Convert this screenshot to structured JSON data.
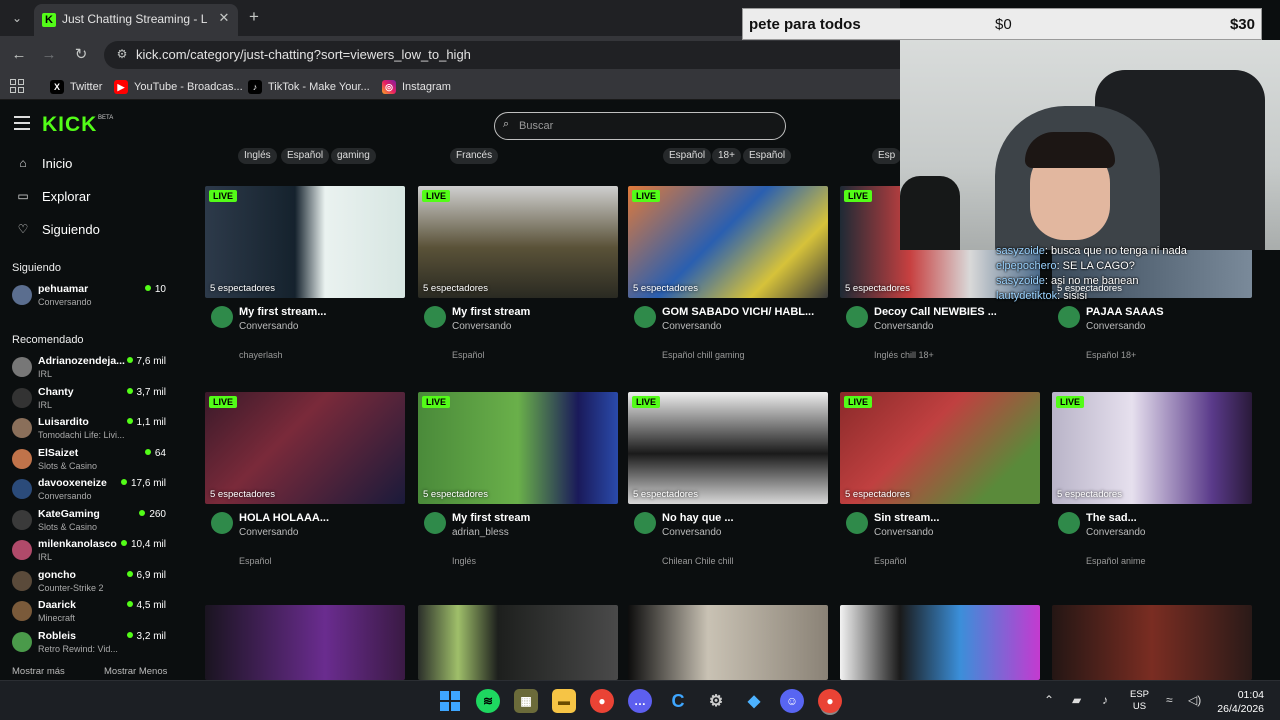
{
  "browser": {
    "tab_title": "Just Chatting Streaming - Live S",
    "url": "kick.com/category/just-chatting?sort=viewers_low_to_high",
    "bookmarks": [
      {
        "label": "Twitter",
        "icon": "x-icon"
      },
      {
        "label": "YouTube - Broadcas...",
        "icon": "youtube-icon"
      },
      {
        "label": "TikTok - Make Your...",
        "icon": "tiktok-icon"
      },
      {
        "label": "Instagram",
        "icon": "instagram-icon"
      }
    ]
  },
  "colors": {
    "accent": "#53fc18",
    "background": "#0b0e0f"
  },
  "kick": {
    "logo": "KICK",
    "logo_badge": "BETA",
    "search_placeholder": "Buscar",
    "nav": [
      {
        "label": "Inicio",
        "icon": "home-icon"
      },
      {
        "label": "Explorar",
        "icon": "explore-icon"
      },
      {
        "label": "Siguiendo",
        "icon": "heart-icon"
      }
    ],
    "following_header": "Siguiendo",
    "following": [
      {
        "name": "pehuamar",
        "category": "Conversando",
        "viewers": "10"
      }
    ],
    "recommended_header": "Recomendado",
    "recommended": [
      {
        "name": "Adrianozendeja...",
        "category": "IRL",
        "viewers": "7,6 mil"
      },
      {
        "name": "Chanty",
        "category": "IRL",
        "viewers": "3,7 mil"
      },
      {
        "name": "Luisardito",
        "category": "Tomodachi Life: Livi...",
        "viewers": "1,1 mil"
      },
      {
        "name": "ElSaizet",
        "category": "Slots & Casino",
        "viewers": "64"
      },
      {
        "name": "davooxeneize",
        "category": "Conversando",
        "viewers": "17,6 mil"
      },
      {
        "name": "KateGaming",
        "category": "Slots & Casino",
        "viewers": "260"
      },
      {
        "name": "milenkanolasco",
        "category": "IRL",
        "viewers": "10,4 mil"
      },
      {
        "name": "goncho",
        "category": "Counter-Strike 2",
        "viewers": "6,9 mil"
      },
      {
        "name": "Daarick",
        "category": "Minecraft",
        "viewers": "4,5 mil"
      },
      {
        "name": "Robleis",
        "category": "Retro Rewind: Vid...",
        "viewers": "3,2 mil"
      }
    ],
    "show_more": "Mostrar más",
    "show_less": "Mostrar Menos",
    "top_tags": [
      "Inglés",
      "Español",
      "gaming",
      "Francés",
      "Español",
      "18+",
      "Español",
      "Esp"
    ],
    "live_label": "LIVE",
    "cards_row1": [
      {
        "viewers": "5 espectadores",
        "title": "My first stream...",
        "channel": "Conversando",
        "tags": "chayerlash"
      },
      {
        "viewers": "5 espectadores",
        "title": "My first stream",
        "channel": "Conversando",
        "tags": "Español"
      },
      {
        "viewers": "5 espectadores",
        "title": "GOM SABADO VICH/ HABL...",
        "channel": "Conversando",
        "tags": "Español  chill  gaming"
      },
      {
        "viewers": "5 espectadores",
        "title": "Decoy Call NEWBIES ...",
        "channel": "Conversando",
        "tags": "Inglés  chill  18+"
      },
      {
        "viewers": "5 espectadores",
        "title": "PAJAA SAAAS",
        "channel": "Conversando",
        "tags": "Español  18+"
      }
    ],
    "cards_row2": [
      {
        "viewers": "5 espectadores",
        "title": "HOLA HOLAAA...",
        "channel": "Conversando",
        "tags": "Español"
      },
      {
        "viewers": "5 espectadores",
        "title": "My first stream",
        "channel": "adrian_bless",
        "tags": "Inglés"
      },
      {
        "viewers": "5 espectadores",
        "title": "No hay que ...",
        "channel": "Conversando",
        "tags": "Chilean  Chile  chill"
      },
      {
        "viewers": "5 espectadores",
        "title": "Sin stream...",
        "channel": "Conversando",
        "tags": "Español"
      },
      {
        "viewers": "5 espectadores",
        "title": "The sad...",
        "channel": "Conversando",
        "tags": "Español  anime"
      }
    ]
  },
  "overlay": {
    "goal_title": "pete para todos",
    "goal_current": "$0",
    "goal_target": "$30",
    "chat": [
      {
        "user": "sasyzoide",
        "msg": ": busca  que no tenga  ni nada"
      },
      {
        "user": "elpepochero",
        "msg": ": SE LA CAGO?"
      },
      {
        "user": "sasyzoide",
        "msg": ": asi no me banean"
      },
      {
        "user": "lautydetiktok",
        "msg": ": sisisi"
      }
    ]
  },
  "taskbar": {
    "lang_top": "ESP",
    "lang_bottom": "US",
    "time": "01:04",
    "date": "26/4/2026"
  }
}
